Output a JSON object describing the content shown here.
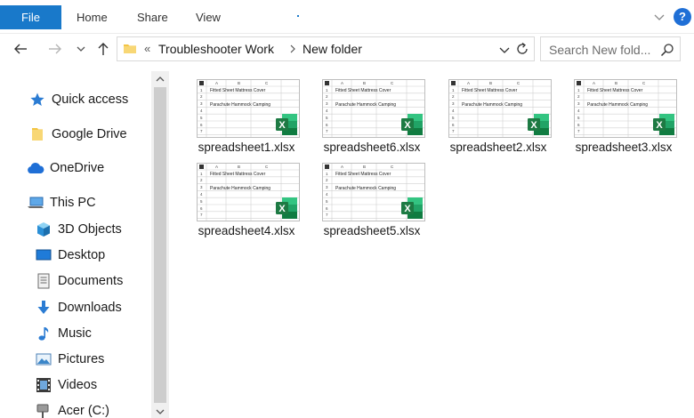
{
  "ribbon": {
    "tabs": [
      "File",
      "Home",
      "Share",
      "View"
    ],
    "help_label": "?"
  },
  "address_bar": {
    "prefix": "«",
    "segments": [
      "Troubleshooter Work",
      "New folder"
    ]
  },
  "search": {
    "placeholder": "Search New fold..."
  },
  "sidebar": {
    "items": [
      {
        "label": "Quick access",
        "icon": "star-icon"
      },
      {
        "label": "Google Drive",
        "icon": "folder-icon"
      },
      {
        "label": "OneDrive",
        "icon": "cloud-icon"
      },
      {
        "label": "This PC",
        "icon": "computer-icon"
      },
      {
        "label": "3D Objects",
        "icon": "cube-icon"
      },
      {
        "label": "Desktop",
        "icon": "desktop-icon"
      },
      {
        "label": "Documents",
        "icon": "document-icon"
      },
      {
        "label": "Downloads",
        "icon": "download-icon"
      },
      {
        "label": "Music",
        "icon": "music-icon"
      },
      {
        "label": "Pictures",
        "icon": "pictures-icon"
      },
      {
        "label": "Videos",
        "icon": "videos-icon"
      },
      {
        "label": "Acer (C:)",
        "icon": "drive-icon"
      }
    ]
  },
  "files": [
    {
      "name": "spreadsheet1.xlsx"
    },
    {
      "name": "spreadsheet6.xlsx"
    },
    {
      "name": "spreadsheet2.xlsx"
    },
    {
      "name": "spreadsheet3.xlsx"
    },
    {
      "name": "spreadsheet4.xlsx"
    },
    {
      "name": "spreadsheet5.xlsx"
    }
  ],
  "thumbnail": {
    "columns": [
      "A",
      "B",
      "C"
    ],
    "rows": [
      "1",
      "2",
      "3",
      "4",
      "5",
      "6",
      "7",
      "8"
    ],
    "row1_text": "Fitted Sheet Mattress Cover",
    "row3_text": "Parachute Hammock Camping"
  },
  "colors": {
    "accent": "#1979ca",
    "excel_green": "#1d7a43"
  }
}
